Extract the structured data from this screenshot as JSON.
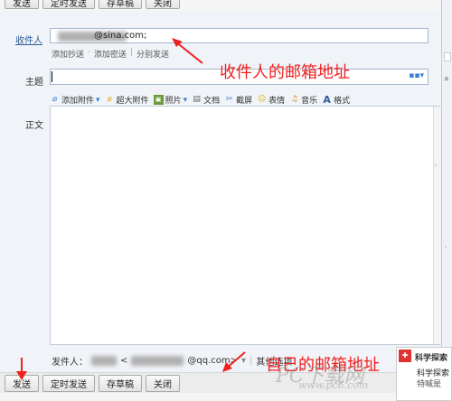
{
  "toolbar": {
    "send": "发送",
    "timed_send": "定时发送",
    "save_draft": "存草稿",
    "close": "关闭"
  },
  "recipient": {
    "label": "收件人",
    "email_suffix": "@sina.com;",
    "add_cc": "添加抄送",
    "add_bcc": "添加密送",
    "separate_send": "分别发送"
  },
  "subject": {
    "label": "主题",
    "value": ""
  },
  "attach_tools": {
    "add_attachment": "添加附件",
    "super_attachment": "超大附件",
    "photo": "照片",
    "document": "文档",
    "screenshot": "截屏",
    "emoji": "表情",
    "music": "音乐",
    "format": "格式"
  },
  "body": {
    "label": "正文"
  },
  "sender": {
    "label": "发件人：",
    "email_suffix": "@qq.com>",
    "other_options": "其他选项"
  },
  "annotations": {
    "recipient_note": "收件人的邮箱地址",
    "sender_note": "自己的邮箱地址"
  },
  "notification": {
    "title": "科学探索",
    "line1": "科学探索",
    "line2": "特喊是"
  },
  "watermark": {
    "main": "PC下载网",
    "url": "www.pc6.com"
  },
  "colors": {
    "annotation": "#f02020",
    "link": "#2d5d9a"
  }
}
